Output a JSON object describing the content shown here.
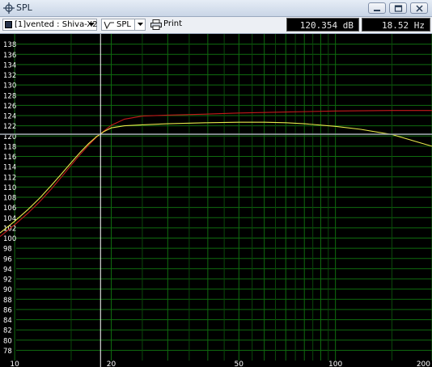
{
  "window": {
    "title": "SPL",
    "icon": "crosshair-icon"
  },
  "toolbar": {
    "curve_select": "[1]vented : Shiva-X2",
    "spl_label": "SPL",
    "print_label": "Print",
    "readout_db": "120.354 dB",
    "readout_hz": "18.52 Hz"
  },
  "colors": {
    "plot_bg": "#000000",
    "grid": "#0f6b0f",
    "grid_alt": "#0a480a",
    "axis_text": "#ffffff",
    "curve_red": "#c41a1a",
    "curve_yellow": "#e8e84a",
    "cursor": "#ffffff"
  },
  "chart_data": {
    "type": "line",
    "x_scale": "log",
    "xlim": [
      9,
      200
    ],
    "ylim": [
      76,
      140
    ],
    "x_tick_labels": [
      "10",
      "20",
      "50",
      "100",
      "200"
    ],
    "x_ticks": [
      10,
      20,
      50,
      100,
      200
    ],
    "y_ticks": [
      78,
      80,
      82,
      84,
      86,
      88,
      90,
      92,
      94,
      96,
      98,
      100,
      102,
      104,
      106,
      108,
      110,
      112,
      114,
      116,
      118,
      120,
      122,
      124,
      126,
      128,
      130,
      132,
      134,
      136,
      138
    ],
    "cursor": {
      "x": 18.52,
      "y": 120.354
    },
    "series": [
      {
        "color": "red",
        "x": [
          9,
          10,
          11,
          12,
          13,
          14,
          15,
          16,
          17,
          18,
          18.52,
          19,
          20,
          22,
          25,
          30,
          40,
          50,
          70,
          100,
          150,
          200
        ],
        "y": [
          100.3,
          102.6,
          104.9,
          107.2,
          109.6,
          112.0,
          114.3,
          116.4,
          118.2,
          119.8,
          120.4,
          121.0,
          122.1,
          123.3,
          123.9,
          124.1,
          124.3,
          124.5,
          124.7,
          124.9,
          125.0,
          125.0
        ]
      },
      {
        "color": "yellow",
        "x": [
          9,
          10,
          11,
          12,
          13,
          14,
          15,
          16,
          17,
          18,
          18.52,
          19,
          20,
          22,
          25,
          30,
          40,
          50,
          60,
          70,
          80,
          100,
          120,
          150,
          200
        ],
        "y": [
          101.0,
          103.3,
          105.6,
          107.9,
          110.3,
          112.6,
          114.8,
          116.8,
          118.5,
          119.9,
          120.4,
          120.9,
          121.6,
          122.0,
          122.2,
          122.4,
          122.6,
          122.7,
          122.7,
          122.6,
          122.4,
          121.9,
          121.3,
          120.3,
          118.0
        ]
      }
    ]
  }
}
